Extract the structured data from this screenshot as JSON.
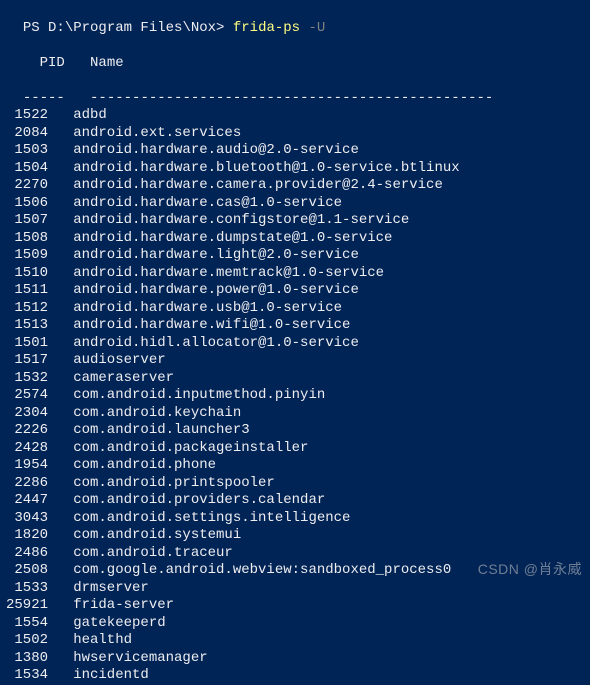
{
  "prompt": {
    "path": "PS D:\\Program Files\\Nox> ",
    "command": "frida-ps ",
    "flag": "-U"
  },
  "header": {
    "pid_label": "  PID",
    "name_label": "Name"
  },
  "separator": {
    "pid_sep": "-----",
    "name_sep": "------------------------------------------------"
  },
  "processes": [
    {
      "pid": "1522",
      "name": "adbd"
    },
    {
      "pid": "2084",
      "name": "android.ext.services"
    },
    {
      "pid": "1503",
      "name": "android.hardware.audio@2.0-service"
    },
    {
      "pid": "1504",
      "name": "android.hardware.bluetooth@1.0-service.btlinux"
    },
    {
      "pid": "2270",
      "name": "android.hardware.camera.provider@2.4-service"
    },
    {
      "pid": "1506",
      "name": "android.hardware.cas@1.0-service"
    },
    {
      "pid": "1507",
      "name": "android.hardware.configstore@1.1-service"
    },
    {
      "pid": "1508",
      "name": "android.hardware.dumpstate@1.0-service"
    },
    {
      "pid": "1509",
      "name": "android.hardware.light@2.0-service"
    },
    {
      "pid": "1510",
      "name": "android.hardware.memtrack@1.0-service"
    },
    {
      "pid": "1511",
      "name": "android.hardware.power@1.0-service"
    },
    {
      "pid": "1512",
      "name": "android.hardware.usb@1.0-service"
    },
    {
      "pid": "1513",
      "name": "android.hardware.wifi@1.0-service"
    },
    {
      "pid": "1501",
      "name": "android.hidl.allocator@1.0-service"
    },
    {
      "pid": "1517",
      "name": "audioserver"
    },
    {
      "pid": "1532",
      "name": "cameraserver"
    },
    {
      "pid": "2574",
      "name": "com.android.inputmethod.pinyin"
    },
    {
      "pid": "2304",
      "name": "com.android.keychain"
    },
    {
      "pid": "2226",
      "name": "com.android.launcher3"
    },
    {
      "pid": "2428",
      "name": "com.android.packageinstaller"
    },
    {
      "pid": "1954",
      "name": "com.android.phone"
    },
    {
      "pid": "2286",
      "name": "com.android.printspooler"
    },
    {
      "pid": "2447",
      "name": "com.android.providers.calendar"
    },
    {
      "pid": "3043",
      "name": "com.android.settings.intelligence"
    },
    {
      "pid": "1820",
      "name": "com.android.systemui"
    },
    {
      "pid": "2486",
      "name": "com.android.traceur"
    },
    {
      "pid": "2508",
      "name": "com.google.android.webview:sandboxed_process0"
    },
    {
      "pid": "1533",
      "name": "drmserver"
    },
    {
      "pid": "25921",
      "name": "frida-server"
    },
    {
      "pid": "1554",
      "name": "gatekeeperd"
    },
    {
      "pid": "1502",
      "name": "healthd"
    },
    {
      "pid": "1380",
      "name": "hwservicemanager"
    },
    {
      "pid": "1534",
      "name": "incidentd"
    }
  ],
  "watermark": "CSDN @肖永威"
}
